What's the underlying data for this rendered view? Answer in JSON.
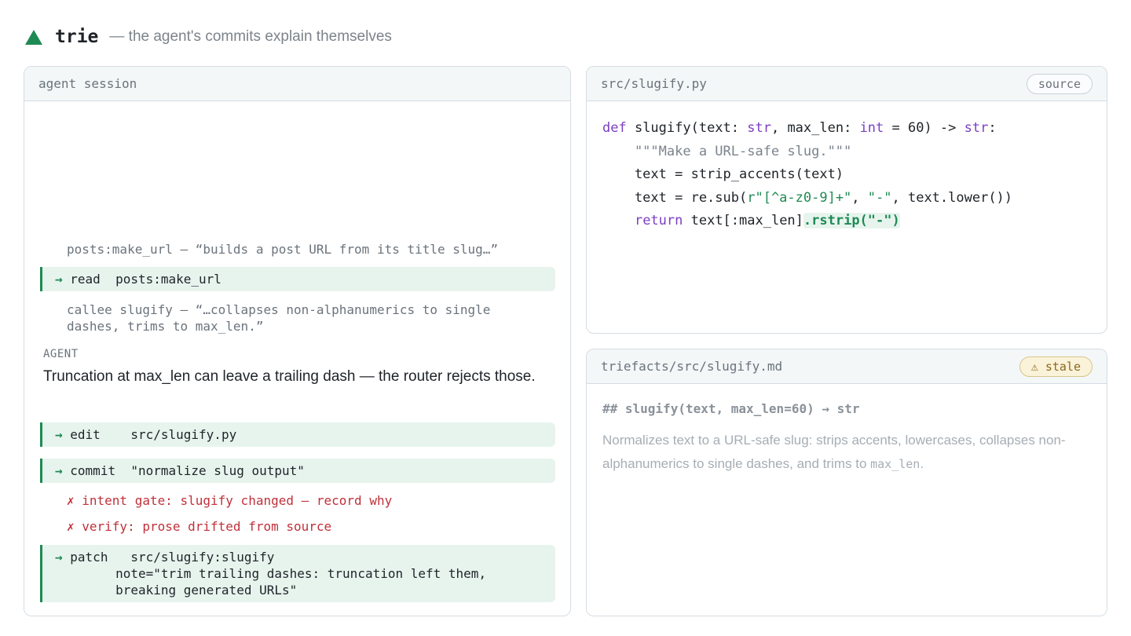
{
  "header": {
    "brand": "trie",
    "tagline": "— the agent's commits explain themselves"
  },
  "session": {
    "title": "agent session",
    "summary1": "posts:make_url — “builds a post URL from its title slug…”",
    "tool_read": {
      "arrow": "→",
      "text": "read  posts:make_url"
    },
    "summary2": "callee slugify — “…collapses non-alphanumerics to single\ndashes, trims to max_len.”",
    "agent_label": "AGENT",
    "agent_text": "Truncation at max_len can leave a trailing dash — the router rejects those.",
    "tool_edit": {
      "arrow": "→",
      "text": "edit    src/slugify.py"
    },
    "tool_commit": {
      "arrow": "→",
      "text": "commit  \"normalize slug output\""
    },
    "error1": "✗ intent gate: slugify changed — record why",
    "error2": "✗ verify: prose drifted from source",
    "tool_patch": {
      "arrow": "→",
      "text": "patch   src/slugify:slugify\n        note=\"trim trailing dashes: truncation left them,\n        breaking generated URLs\""
    }
  },
  "source": {
    "title": "src/slugify.py",
    "badge": "source",
    "code": {
      "l1_def": "def",
      "l1_a": " slugify(text: ",
      "l1_str1": "str",
      "l1_b": ", max_len: ",
      "l1_int": "int",
      "l1_c": " = 60) -> ",
      "l1_str2": "str",
      "l1_d": ":",
      "l2": "    \"\"\"Make a URL-safe slug.\"\"\"",
      "l3": "    text = strip_accents(text)",
      "l4_a": "    text = re.sub(",
      "l4_s1": "r\"[^a-z0-9]+\"",
      "l4_b": ", ",
      "l4_s2": "\"-\"",
      "l4_c": ", text.lower())",
      "l5_indent": "    ",
      "l5_return": "return",
      "l5_a": " text[:max_len]",
      "l5_hl": ".rstrip(\"-\")"
    }
  },
  "facts": {
    "title": "triefacts/src/slugify.md",
    "badge": "⚠ stale",
    "heading": "## slugify(text, max_len=60) → str",
    "text_a": "Normalizes text to a URL-safe slug: strips accents, lowercases, collapses non-alphanumerics to single dashes, and trims to ",
    "text_code": "max_len",
    "text_b": "."
  },
  "colors": {
    "accent": "#1f8a54",
    "error": "#c0303a",
    "keyword": "#7b3fc4",
    "stale": "#8a6a1c"
  }
}
